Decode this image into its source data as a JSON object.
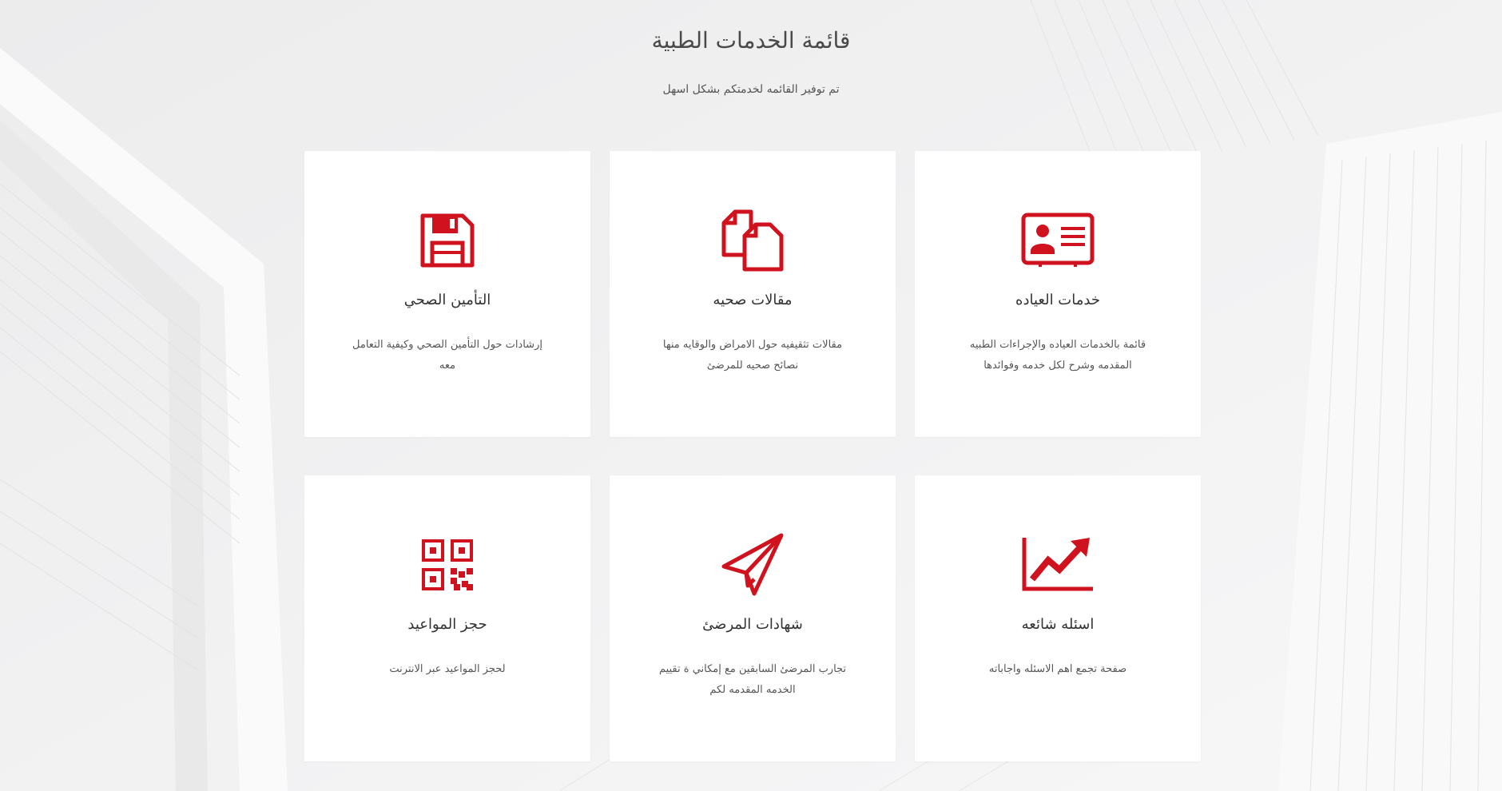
{
  "header": {
    "title": "قائمة الخدمات الطبية",
    "subtitle": "تم توفير القائمه لخدمتكم بشكل اسهل"
  },
  "accent_color": "#d0121f",
  "cards": [
    {
      "icon": "id-card-icon",
      "title": "خدمات العياده",
      "description": "قائمة بالخدمات العياده والإجراءات الطبيه المقدمه وشرح لكل خدمه وفوائدها"
    },
    {
      "icon": "documents-icon",
      "title": "مقالات صحيه",
      "description": "مقالات تثقيفيه حول الامراض والوقايه منها نصائح صحيه للمرضئ"
    },
    {
      "icon": "floppy-disk-icon",
      "title": "التأمين الصحي",
      "description": "إرشادات حول التأمين الصحي وكيفية التعامل معه"
    },
    {
      "icon": "trend-chart-icon",
      "title": "اسئله شائعه",
      "description": "صفحة تجمع اهم الاسئله واجاباته"
    },
    {
      "icon": "paper-plane-icon",
      "title": "شهادات المرضئ",
      "description": "تجارب المرضئ السابقين مع إمكاني ة تقييم الخدمه المقدمه لكم"
    },
    {
      "icon": "qr-code-icon",
      "title": "حجز المواعيد",
      "description": "لحجز المواعيد عبر الانترنت"
    }
  ]
}
